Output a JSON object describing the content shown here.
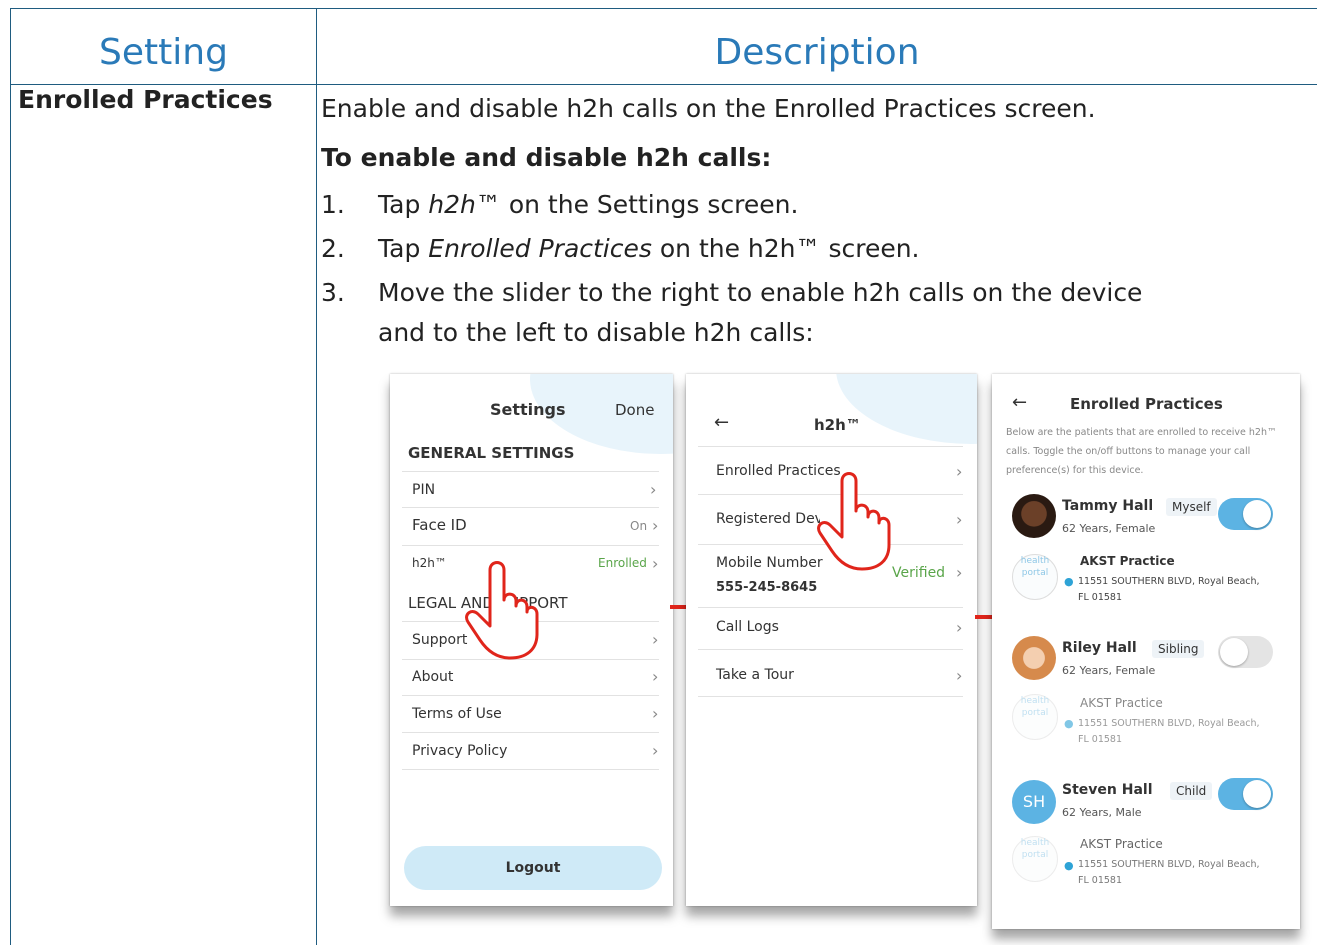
{
  "table": {
    "header_setting": "Setting",
    "header_description": "Description",
    "setting_name": "Enrolled Practices",
    "intro": "Enable and disable h2h calls on the Enrolled Practices screen.",
    "procedure_title": "To enable and disable h2h calls:",
    "steps": [
      {
        "num": "1.",
        "pre": "Tap ",
        "em": "h2h",
        "post": "™ on the Settings screen."
      },
      {
        "num": "2.",
        "pre": "Tap ",
        "em": "Enrolled Practices",
        "post": " on the h2h™ screen."
      },
      {
        "num": "3.",
        "line1": "Move the slider to the right to enable h2h calls on the device",
        "line2": "and to the left to disable h2h calls:"
      }
    ]
  },
  "screen_settings": {
    "title": "Settings",
    "done": "Done",
    "section_general": "GENERAL SETTINGS",
    "items": [
      {
        "label": "PIN",
        "value": ""
      },
      {
        "label": "Face ID",
        "value": "On"
      },
      {
        "label": "h2h™",
        "value": "Enrolled"
      }
    ],
    "section_legal": "LEGAL AND SUPPORT",
    "legal_items": [
      "Support",
      "About",
      "Terms of Use",
      "Privacy Policy"
    ],
    "logout": "Logout"
  },
  "screen_h2h": {
    "title": "h2h™",
    "items": [
      "Enrolled Practices",
      "Registered Devices",
      "Mobile Number",
      "Call Logs",
      "Take a Tour"
    ],
    "mobile_number": "555-245-8645",
    "verified": "Verified"
  },
  "screen_enrolled": {
    "title": "Enrolled Practices",
    "intro_line1": "Below are the patients that are enrolled to receive h2h™",
    "intro_line2": "calls. Toggle the on/off buttons to manage your call",
    "intro_line3": "preference(s) for this device.",
    "patients": [
      {
        "name": "Tammy Hall",
        "relation": "Myself",
        "details": "62 Years, Female",
        "practice": "AKST Practice",
        "address1": "11551 SOUTHERN BLVD, Royal Beach,",
        "address2": "FL 01581",
        "enabled": true
      },
      {
        "name": "Riley Hall",
        "relation": "Sibling",
        "details": "62 Years, Female",
        "practice": "AKST Practice",
        "address1": "11551 SOUTHERN BLVD, Royal Beach,",
        "address2": "FL 01581",
        "enabled": false
      },
      {
        "name": "Steven Hall",
        "relation": "Child",
        "details": "62 Years, Male",
        "practice": "AKST Practice",
        "address1": "11551 SOUTHERN BLVD, Royal Beach,",
        "address2": "FL 01581",
        "enabled": true,
        "initials": "SH"
      }
    ],
    "logo_text_1": "health",
    "logo_text_2": "portal"
  },
  "colors": {
    "accent": "#2a7ab8",
    "border": "#1f5c80",
    "arrow": "#e0251b",
    "toggle_on": "#5cb3e3",
    "toggle_off": "#e4e4e4"
  }
}
